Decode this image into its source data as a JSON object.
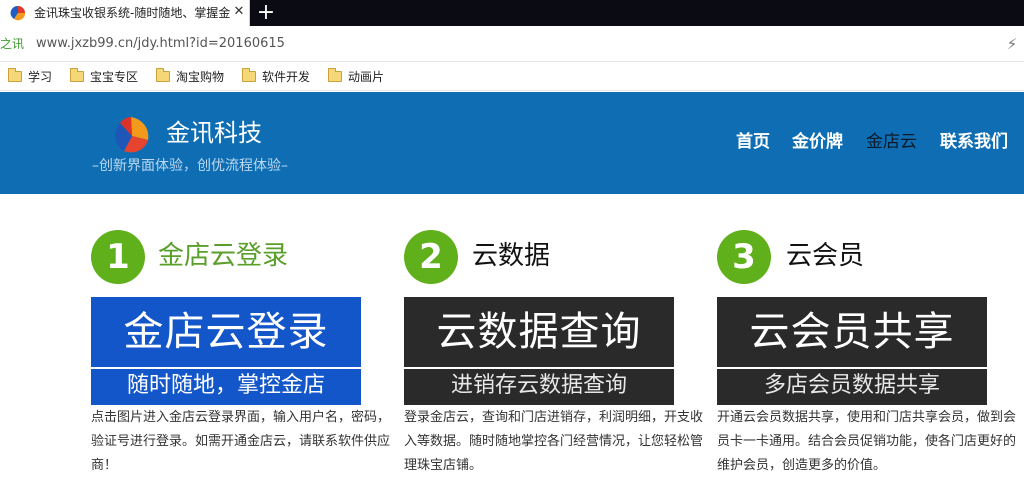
{
  "browser": {
    "tab_title": "金讯珠宝收银系统-随时随地、掌握金",
    "tab_close": "✕",
    "new_tab": "+",
    "site_badge": "之讯",
    "url": "www.jxzb99.cn/jdy.html?id=20160615",
    "bolt": "⚡"
  },
  "bookmarks": [
    "学习",
    "宝宝专区",
    "淘宝购物",
    "软件开发",
    "动画片"
  ],
  "header": {
    "brand": "金讯科技",
    "slogan": "–创新界面体验，创优流程体验–",
    "nav": [
      "首页",
      "金价牌",
      "金店云",
      "联系我们"
    ],
    "colors": {
      "header_bg": "#0f6eb3",
      "step_green": "#5fb01a"
    }
  },
  "steps": [
    {
      "number": "1",
      "title": "金店云登录",
      "card_big": "金店云登录",
      "card_sub": "随时随地，掌控金店",
      "desc": "点击图片进入金店云登录界面，输入用户名，密码，验证号进行登录。如需开通金店云，请联系软件供应商！"
    },
    {
      "number": "2",
      "title": "云数据",
      "card_big": "云数据查询",
      "card_sub": "进销存云数据查询",
      "desc": "登录金店云，查询和门店进销存，利润明细，开支收入等数据。随时随地掌控各门经营情况，让您轻松管理珠宝店铺。"
    },
    {
      "number": "3",
      "title": "云会员",
      "card_big": "云会员共享",
      "card_sub": "多店会员数据共享",
      "desc": "开通云会员数据共享，使用和门店共享会员，做到会员卡一卡通用。结合会员促销功能，使各门店更好的维护会员，创造更多的价值。"
    }
  ]
}
